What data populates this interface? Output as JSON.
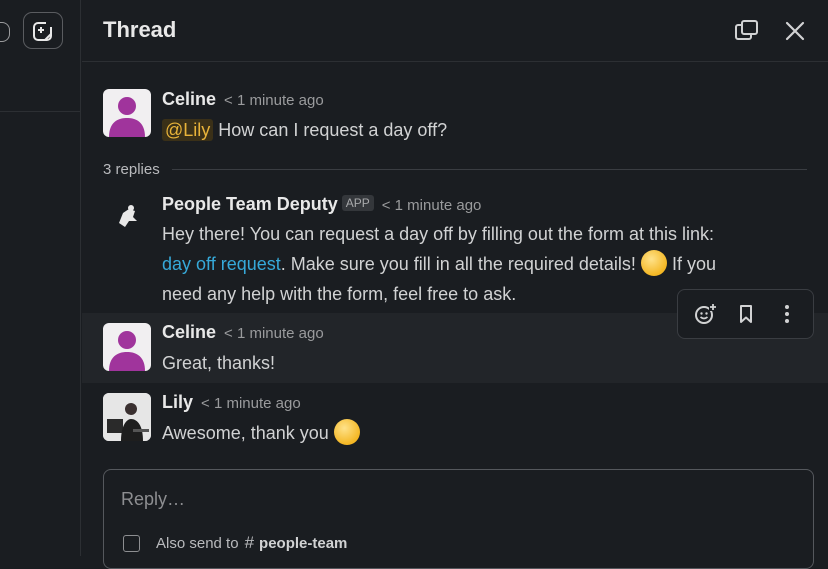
{
  "header": {
    "title": "Thread"
  },
  "parent_message": {
    "author": "Celine",
    "time": "1 minute ago",
    "mention": "@Lily",
    "text": "How can I request a day off?"
  },
  "replies_label": "3 replies",
  "replies": [
    {
      "author": "People Team Deputy",
      "badge": "APP",
      "time": "1 minute ago",
      "line1": "Hey there! You can request a day off by filling out the form at this link:",
      "link_text": "day off request",
      "line2_after_link": ". Make sure you fill in all the required details!",
      "line2_tail": "If you",
      "line3": "need any help with the form, feel free to ask."
    },
    {
      "author": "Celine",
      "time": "1 minute ago",
      "text": "Great, thanks!"
    },
    {
      "author": "Lily",
      "time": "1 minute ago",
      "text": "Awesome, thank you"
    }
  ],
  "composer": {
    "placeholder": "Reply…",
    "also_send_label": "Also send to",
    "channel_hash": "#",
    "channel": "people-team"
  },
  "icons": {
    "compose": "compose-icon",
    "popout": "popout-icon",
    "close": "close-icon",
    "add_reaction": "add-reaction-icon",
    "bookmark": "bookmark-icon",
    "more": "more-actions-icon"
  },
  "colors": {
    "background": "#1a1d21",
    "mention": "#e8b33a",
    "link": "#36a9d9",
    "avatar_purple": "#a0349c"
  }
}
